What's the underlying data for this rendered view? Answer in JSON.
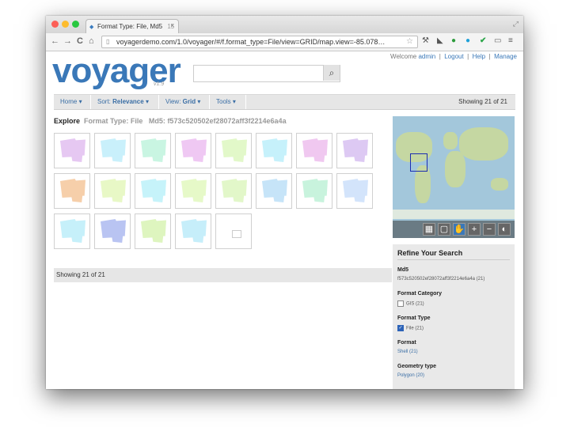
{
  "browser": {
    "tab_title": "Format Type: File, Md5",
    "tab_extra": "15",
    "url": "voyagerdemo.com/1.0/voyager/#/f.format_type=File/view=GRID/map.view=-85.078…",
    "nav_back": "←",
    "nav_forward": "→",
    "nav_reload": "C",
    "nav_home": "⌂"
  },
  "header": {
    "logo": "voyager",
    "version": "v1.9",
    "search_placeholder": "",
    "welcome_prefix": "Welcome ",
    "user": "admin",
    "links": [
      "Logout",
      "Help",
      "Manage"
    ]
  },
  "toolbar": {
    "home": "Home",
    "sort_prefix": "Sort: ",
    "sort_value": "Relevance",
    "view_prefix": "View: ",
    "view_value": "Grid",
    "tools": "Tools",
    "showing": "Showing 21 of 21"
  },
  "breadcrumb": {
    "explore": "Explore",
    "filter1_key": "Format Type:",
    "filter1_value": "File",
    "filter2_key": "Md5:",
    "filter2_value": "f573c520502ef28072aff3f2214e6a4a"
  },
  "results": {
    "colors": [
      "#e6c8f2",
      "#c9f0fb",
      "#c9f5e2",
      "#efc8f3",
      "#e2f8c9",
      "#c6f1fb",
      "#f0c8f0",
      "#ddc9f3",
      "#f6cfaa",
      "#e8f8c6",
      "#c6f3fa",
      "#e6f9c8",
      "#e2f7c9",
      "#c6e4f8",
      "#c8f3dd",
      "#d3e4fb",
      "#c6f0fa",
      "#b9c4f2",
      "#def5bf",
      "#c6eefa"
    ],
    "footer": "Showing 21 of 21"
  },
  "refine": {
    "title": "Refine Your Search",
    "md5_label": "Md5",
    "md5_value": "f573c520502ef28072aff3f2214e6a4a (21)",
    "format_category_label": "Format Category",
    "format_category_value": "GIS (21)",
    "format_type_label": "Format Type",
    "format_type_value": "File (21)",
    "format_label": "Format",
    "format_value": "Shell (21)",
    "geometry_label": "Geometry type",
    "geometry_value": "Polygon (20)"
  },
  "colors": {
    "brand_blue": "#3a78b8"
  }
}
